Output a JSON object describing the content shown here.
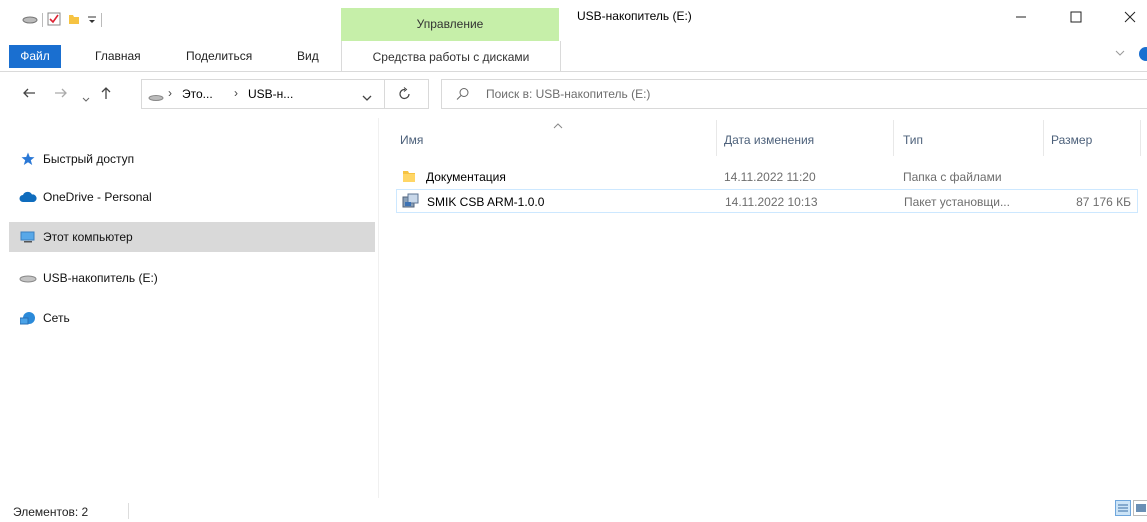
{
  "window": {
    "title": "USB-накопитель (E:)",
    "contextual_tab_group": "Управление"
  },
  "ribbon": {
    "tabs": [
      "Файл",
      "Главная",
      "Поделиться",
      "Вид"
    ],
    "contextual_tab": "Средства работы с дисками",
    "accent_color": "#1a6fd0",
    "contextual_color": "#c6efa9"
  },
  "address": {
    "crumbs": [
      "Это...",
      "USB-н..."
    ],
    "search_placeholder": "Поиск в: USB-накопитель (E:)"
  },
  "nav_pane": {
    "items": [
      {
        "label": "Быстрый доступ",
        "icon": "star-icon"
      },
      {
        "label": "OneDrive - Personal",
        "icon": "cloud-icon"
      },
      {
        "label": "Этот компьютер",
        "icon": "computer-icon",
        "selected": true
      },
      {
        "label": "USB-накопитель (E:)",
        "icon": "usb-drive-icon"
      },
      {
        "label": "Сеть",
        "icon": "network-icon"
      }
    ]
  },
  "file_list": {
    "columns": [
      "Имя",
      "Дата изменения",
      "Тип",
      "Размер"
    ],
    "rows": [
      {
        "name": "Документация",
        "date": "14.11.2022 11:20",
        "type": "Папка с файлами",
        "size": "",
        "icon": "folder-icon"
      },
      {
        "name": "SMIK CSB ARM-1.0.0",
        "date": "14.11.2022 10:13",
        "type": "Пакет установщи...",
        "size": "87 176 КБ",
        "icon": "installer-icon",
        "selected": true
      }
    ]
  },
  "status_bar": {
    "count_text": "Элементов: 2"
  }
}
